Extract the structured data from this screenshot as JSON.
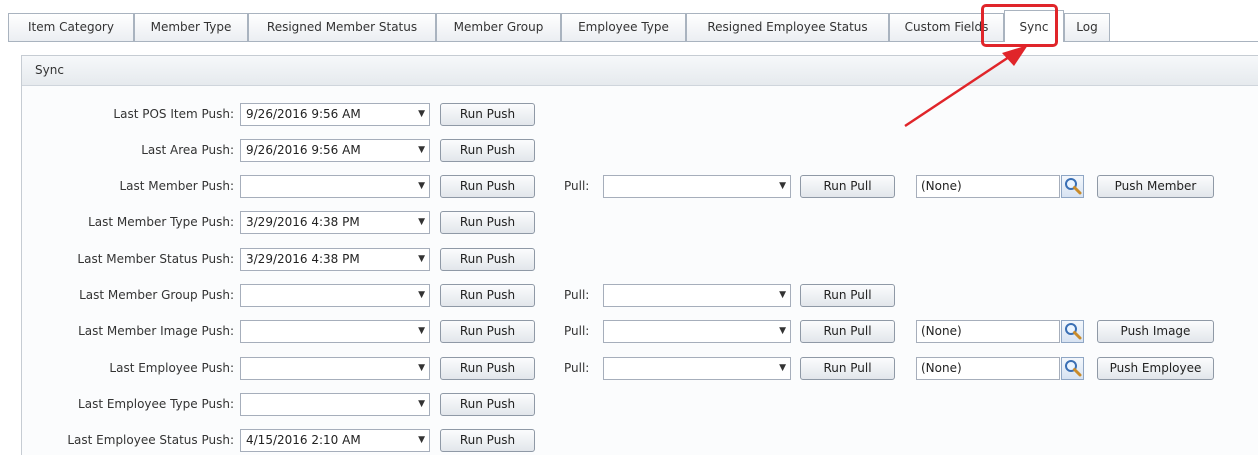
{
  "tabs": [
    {
      "label": "Item Category"
    },
    {
      "label": "Member Type"
    },
    {
      "label": "Resigned Member Status"
    },
    {
      "label": "Member Group"
    },
    {
      "label": "Employee Type"
    },
    {
      "label": "Resigned Employee Status"
    },
    {
      "label": "Custom Fields"
    },
    {
      "label": "Sync",
      "active": true
    },
    {
      "label": "Log"
    }
  ],
  "panel": {
    "title": "Sync"
  },
  "rows": [
    {
      "label": "Last POS Item Push:",
      "value": "9/26/2016 9:56 AM",
      "push_label": "Run Push"
    },
    {
      "label": "Last Area Push:",
      "value": "9/26/2016 9:56 AM",
      "push_label": "Run Push"
    },
    {
      "label": "Last Member Push:",
      "value": "",
      "push_label": "Run Push",
      "pull": {
        "label": "Pull:",
        "value": "",
        "button": "Run Pull"
      },
      "extra": {
        "value": "(None)",
        "button": "Push Member"
      }
    },
    {
      "label": "Last Member Type Push:",
      "value": "3/29/2016 4:38 PM",
      "push_label": "Run Push"
    },
    {
      "label": "Last Member Status Push:",
      "value": "3/29/2016 4:38 PM",
      "push_label": "Run Push"
    },
    {
      "label": "Last Member Group Push:",
      "value": "",
      "push_label": "Run Push",
      "pull": {
        "label": "Pull:",
        "value": "",
        "button": "Run Pull"
      }
    },
    {
      "label": "Last Member Image Push:",
      "value": "",
      "push_label": "Run Push",
      "pull": {
        "label": "Pull:",
        "value": "",
        "button": "Run Pull"
      },
      "extra": {
        "value": "(None)",
        "button": "Push Image"
      }
    },
    {
      "label": "Last Employee Push:",
      "value": "",
      "push_label": "Run Push",
      "pull": {
        "label": "Pull:",
        "value": "",
        "button": "Run Pull"
      },
      "extra": {
        "value": "(None)",
        "button": "Push Employee"
      }
    },
    {
      "label": "Last Employee Type Push:",
      "value": "",
      "push_label": "Run Push"
    },
    {
      "label": "Last Employee Status Push:",
      "value": "4/15/2016 2:10 AM",
      "push_label": "Run Push"
    }
  ],
  "icons": {
    "dropdown": "chevron-down-icon",
    "search": "magnifier-search-icon"
  },
  "colors": {
    "annotation": "#e0252a",
    "tab_border": "#a9b3bf"
  }
}
